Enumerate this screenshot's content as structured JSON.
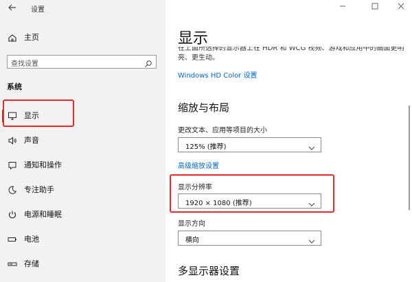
{
  "window": {
    "title": "设置",
    "back_icon": "back-arrow-icon",
    "controls": [
      "minimize-icon",
      "maximize-icon",
      "close-icon"
    ]
  },
  "sidebar": {
    "home_label": "主页",
    "search_placeholder": "查找设置",
    "section_heading": "系统",
    "items": [
      {
        "label": "显示",
        "icon": "monitor-icon",
        "selected": true
      },
      {
        "label": "声音",
        "icon": "speaker-icon"
      },
      {
        "label": "通知和操作",
        "icon": "notification-icon"
      },
      {
        "label": "专注助手",
        "icon": "moon-icon"
      },
      {
        "label": "电源和睡眠",
        "icon": "power-icon"
      },
      {
        "label": "电池",
        "icon": "battery-icon"
      },
      {
        "label": "存储",
        "icon": "storage-icon"
      }
    ]
  },
  "main": {
    "page_title": "显示",
    "clipped_description": "在上面所选择的显示器上在 HDR 和 WCG 视频、游戏和应用中的画面更明亮、更生动。",
    "hd_color_link": "Windows HD Color 设置",
    "scale_section_title": "缩放与布局",
    "text_size_label": "更改文本、应用等项目的大小",
    "text_size_value": "125% (推荐)",
    "advanced_scaling_link": "高级缩放设置",
    "resolution_label": "显示分辨率",
    "resolution_value": "1920 × 1080 (推荐)",
    "orientation_label": "显示方向",
    "orientation_value": "横向",
    "multi_display_title": "多显示器设置"
  },
  "colors": {
    "accent": "#0067c0",
    "highlight_box": "#e5262b",
    "sidebar_bg": "#f2f2f2"
  }
}
